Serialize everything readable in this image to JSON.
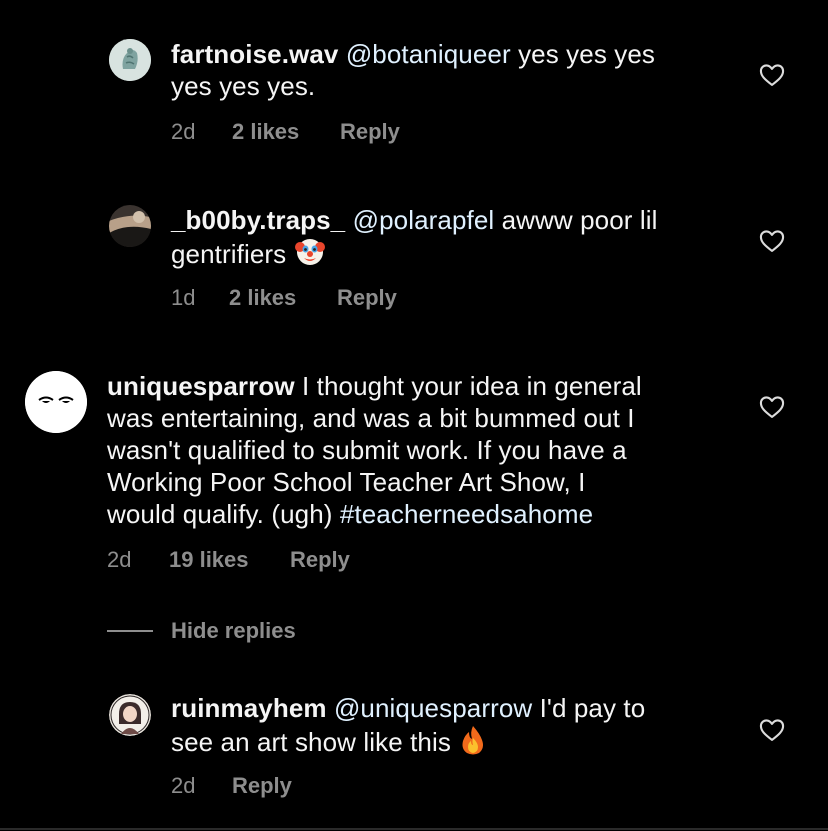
{
  "comments": [
    {
      "username": "fartnoise.wav",
      "mention": "@botaniqueer",
      "line1_rest": " yes yes yes",
      "line2": "yes yes yes.",
      "time": "2d",
      "likes": "2 likes",
      "reply": "Reply"
    },
    {
      "username": "_b00by.traps_",
      "mention": "@polarapfel",
      "line1_rest": " awww poor lil",
      "line2": "gentrifiers",
      "time": "1d",
      "likes": "2 likes",
      "reply": "Reply"
    },
    {
      "username": "uniquesparrow",
      "line1_rest": " I thought your idea in general",
      "line2": "was entertaining, and was a bit bummed out I",
      "line3": "wasn't qualified to submit work. If you have a",
      "line4": "Working Poor School Teacher Art Show, I",
      "line5_start": "would qualify. (ugh) ",
      "hashtag": "#teacherneedsahome",
      "time": "2d",
      "likes": "19 likes",
      "reply": "Reply"
    },
    {
      "username": "ruinmayhem",
      "mention": "@uniquesparrow",
      "line1_rest": " I'd pay to",
      "line2": "see an art show like this",
      "time": "2d",
      "reply": "Reply"
    }
  ],
  "hide_replies": "Hide replies",
  "icons": {
    "like": "heart-icon",
    "clown": "clown-emoji",
    "fire": "fire-emoji"
  },
  "colors": {
    "background": "#000000",
    "text": "#f5f5f5",
    "mention": "#e0f1ff",
    "meta": "#8e8e8e"
  }
}
